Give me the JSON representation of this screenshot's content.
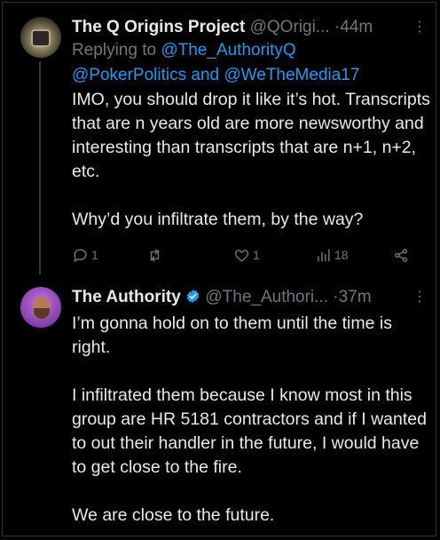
{
  "tweets": [
    {
      "name": "The Q Origins Project",
      "handle": "@QOrigi...",
      "separator": "·",
      "time": "44m",
      "more": "⋮",
      "reply_prefix": "Replying to ",
      "reply_mention_1": "@The_AuthorityQ",
      "reply_mention_2": "@PokerPolitics",
      "reply_and": " and ",
      "reply_mention_3": "@WeTheMedia17",
      "paragraphs": [
        "IMO, you should drop it like it’s hot. Transcripts that are n years old are more newsworthy and interesting than transcripts that are n+1, n+2, etc.",
        "Why’d you infiltrate them, by the way?"
      ],
      "reply_count": "1",
      "retweet_count": "",
      "like_count": "1",
      "view_count": "18",
      "icons": [
        "reply-icon",
        "retweet-icon",
        "like-icon",
        "views-icon",
        "share-icon"
      ]
    },
    {
      "name": "The Authority",
      "handle": "@The_Authori...",
      "separator": "·",
      "time": "37m",
      "more": "⋮",
      "verified_color": "#1d9bf0",
      "paragraphs": [
        "I’m gonna hold on to them until the time is right.",
        "I infiltrated them because I know most in this group are HR 5181 contractors and if I wanted to out their handler in the future, I would have to get close to the fire.",
        "We are close to the future."
      ]
    }
  ],
  "colors": {
    "background": "#000000",
    "text": "#e7e9ea",
    "muted": "#71767b",
    "link": "#1d9bf0",
    "line": "#333639"
  }
}
